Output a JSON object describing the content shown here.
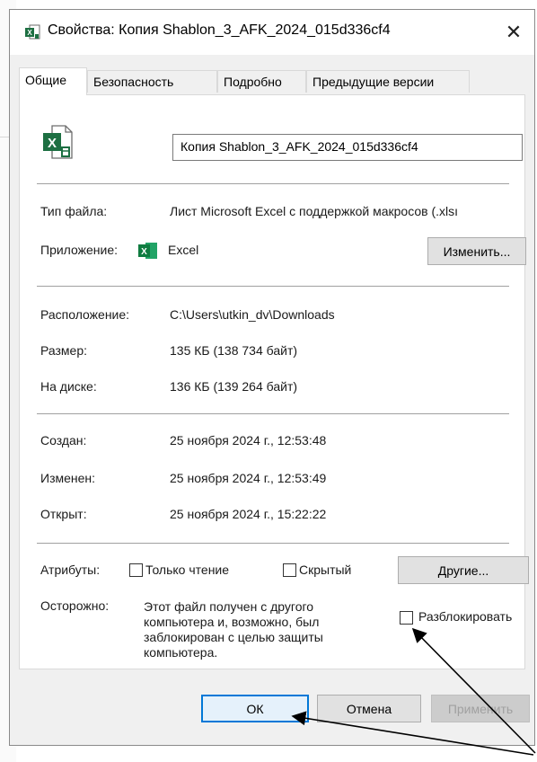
{
  "window": {
    "title": "Свойства: Копия Shablon_3_AFK_2024_015d336cf4",
    "close_symbol": "✕",
    "icon": "excel-file-icon"
  },
  "tabs": [
    {
      "label": "Общие",
      "active": true
    },
    {
      "label": "Безопасность",
      "active": false
    },
    {
      "label": "Подробно",
      "active": false
    },
    {
      "label": "Предыдущие версии",
      "active": false
    }
  ],
  "general": {
    "file_icon": "excel-macro-file-icon",
    "file_name": "Копия Shablon_3_AFK_2024_015d336cf4",
    "file_type_label": "Тип файла:",
    "file_type_value": "Лист Microsoft Excel с поддержкой макросов (.xlsı",
    "app_label": "Приложение:",
    "app_icon": "excel-app-icon",
    "app_value": "Excel",
    "change_button": "Изменить...",
    "location_label": "Расположение:",
    "location_value": "C:\\Users\\utkin_dv\\Downloads",
    "size_label": "Размер:",
    "size_value": "135 КБ (138 734 байт)",
    "disk_label": "На диске:",
    "disk_value": "136 КБ (139 264 байт)",
    "created_label": "Создан:",
    "created_value": "25 ноября 2024 г., 12:53:48",
    "modified_label": "Изменен:",
    "modified_value": "25 ноября 2024 г., 12:53:49",
    "opened_label": "Открыт:",
    "opened_value": "25 ноября 2024 г., 15:22:22",
    "attributes_label": "Атрибуты:",
    "readonly_label": "Только чтение",
    "readonly_checked": false,
    "hidden_label": "Скрытый",
    "hidden_checked": false,
    "other_button": "Другие...",
    "warning_label": "Осторожно:",
    "warning_text": "Этот файл получен с другого компьютера и, возможно, был заблокирован с целью защиты компьютера.",
    "unblock_label": "Разблокировать",
    "unblock_checked": false
  },
  "footer": {
    "ok_button": "ОК",
    "cancel_button": "Отмена",
    "apply_button": "Применить"
  },
  "colors": {
    "accent": "#0078d7",
    "excel_green": "#1d6f42"
  }
}
